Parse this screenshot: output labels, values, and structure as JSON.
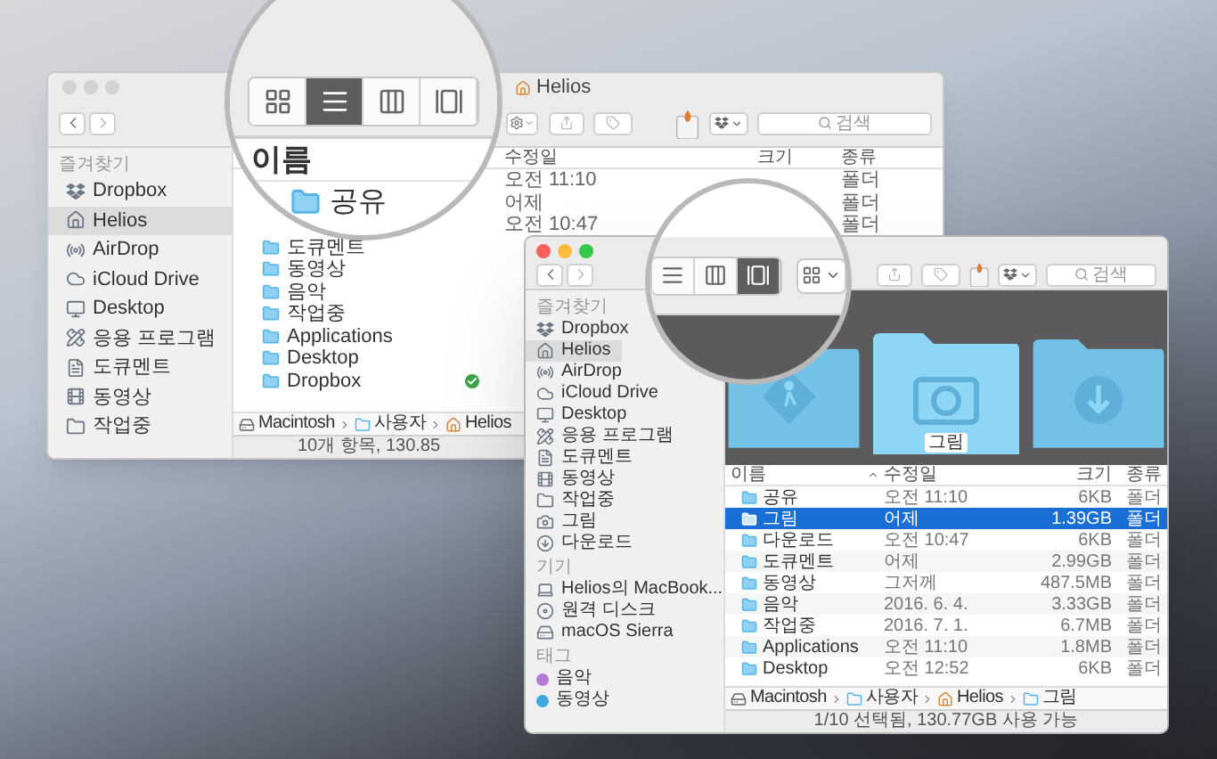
{
  "back_window": {
    "active": false,
    "title": "Helios",
    "search": {
      "placeholder": "검색"
    },
    "sidebar": [
      {
        "heading": "즐겨찾기",
        "items": [
          {
            "kind": "dropbox",
            "label": "Dropbox",
            "selected": false
          },
          {
            "kind": "home",
            "label": "Helios",
            "selected": true
          },
          {
            "kind": "airdrop",
            "label": "AirDrop",
            "selected": false
          },
          {
            "kind": "cloud",
            "label": "iCloud Drive",
            "selected": false
          },
          {
            "kind": "desktop",
            "label": "Desktop",
            "selected": false
          },
          {
            "kind": "apps",
            "label": "응용 프로그램",
            "selected": false
          },
          {
            "kind": "document",
            "label": "도큐멘트",
            "selected": false
          },
          {
            "kind": "film",
            "label": "동영상",
            "selected": false
          },
          {
            "kind": "folder",
            "label": "작업중",
            "selected": false
          }
        ]
      }
    ],
    "columns": {
      "modified": "수정일",
      "size": "크기",
      "type": "종류"
    },
    "rows": [
      {
        "modified": "오전 11:10",
        "type": "폴더",
        "synced": false
      },
      {
        "modified": "어제",
        "type": "폴더",
        "synced": false
      },
      {
        "modified": "오전 10:47",
        "type": "폴더",
        "synced": false
      },
      {
        "name": "도큐멘트",
        "synced": false
      },
      {
        "name": "동영상",
        "synced": false
      },
      {
        "name": "음악",
        "synced": false
      },
      {
        "name": "작업중",
        "synced": false
      },
      {
        "name": "Applications",
        "synced": false
      },
      {
        "name": "Desktop",
        "synced": false
      },
      {
        "name": "Dropbox",
        "synced": true
      }
    ],
    "path": [
      {
        "kind": "drive",
        "label": "Macintosh"
      },
      {
        "kind": "folder",
        "label": "사용자"
      },
      {
        "kind": "home",
        "label": "Helios"
      }
    ],
    "status": "10개 항목, 130.85"
  },
  "front_window": {
    "active": true,
    "search": {
      "placeholder": "검색"
    },
    "sidebar": [
      {
        "heading": "즐겨찾기",
        "items": [
          {
            "kind": "dropbox",
            "label": "Dropbox",
            "selected": false
          },
          {
            "kind": "home",
            "label": "Helios",
            "selected": true
          },
          {
            "kind": "airdrop",
            "label": "AirDrop",
            "selected": false
          },
          {
            "kind": "cloud",
            "label": "iCloud Drive",
            "selected": false
          },
          {
            "kind": "desktop",
            "label": "Desktop",
            "selected": false
          },
          {
            "kind": "apps",
            "label": "응용 프로그램",
            "selected": false
          },
          {
            "kind": "document",
            "label": "도큐멘트",
            "selected": false
          },
          {
            "kind": "film",
            "label": "동영상",
            "selected": false
          },
          {
            "kind": "folder",
            "label": "작업중",
            "selected": false
          },
          {
            "kind": "camera",
            "label": "그림",
            "selected": false
          },
          {
            "kind": "download",
            "label": "다운로드",
            "selected": false
          }
        ]
      },
      {
        "heading": "기기",
        "items": [
          {
            "kind": "laptop",
            "label": "Helios의 MacBook...",
            "selected": false
          },
          {
            "kind": "disc",
            "label": "원격 디스크",
            "selected": false
          },
          {
            "kind": "drive",
            "label": "macOS Sierra",
            "selected": false
          }
        ]
      },
      {
        "heading": "태그",
        "items": [
          {
            "kind": "tag",
            "label": "음악",
            "color": "#b57ad6",
            "selected": false
          },
          {
            "kind": "tag",
            "label": "동영상",
            "color": "#3fa6e0",
            "selected": false
          }
        ]
      }
    ],
    "preview": {
      "label": "그림"
    },
    "columns": {
      "name": "이름",
      "modified": "수정일",
      "size": "크기",
      "type": "종류"
    },
    "rows": [
      {
        "name": "공유",
        "modified": "오전 11:10",
        "size": "6KB",
        "type": "폴더",
        "selected": false
      },
      {
        "name": "그림",
        "modified": "어제",
        "size": "1.39GB",
        "type": "폴더",
        "selected": true
      },
      {
        "name": "다운로드",
        "modified": "오전 10:47",
        "size": "6KB",
        "type": "폴더",
        "selected": false
      },
      {
        "name": "도큐멘트",
        "modified": "어제",
        "size": "2.99GB",
        "type": "폴더",
        "selected": false
      },
      {
        "name": "동영상",
        "modified": "그저께",
        "size": "487.5MB",
        "type": "폴더",
        "selected": false
      },
      {
        "name": "음악",
        "modified": "2016. 6. 4.",
        "size": "3.33GB",
        "type": "폴더",
        "selected": false
      },
      {
        "name": "작업중",
        "modified": "2016. 7. 1.",
        "size": "6.7MB",
        "type": "폴더",
        "selected": false
      },
      {
        "name": "Applications",
        "modified": "오전 11:10",
        "size": "1.8MB",
        "type": "폴더",
        "selected": false
      },
      {
        "name": "Desktop",
        "modified": "오전 12:52",
        "size": "6KB",
        "type": "폴더",
        "selected": false
      }
    ],
    "path": [
      {
        "kind": "drive",
        "label": "Macintosh"
      },
      {
        "kind": "folder",
        "label": "사용자"
      },
      {
        "kind": "home",
        "label": "Helios"
      },
      {
        "kind": "folder",
        "label": "그림"
      }
    ],
    "status": "1/10 선택됨, 130.77GB 사용 가능"
  },
  "magnifiers": [
    {
      "view_buttons": [
        {
          "kind": "icon",
          "selected": false
        },
        {
          "kind": "list",
          "selected": true
        },
        {
          "kind": "column",
          "selected": false
        },
        {
          "kind": "coverflow",
          "selected": false
        }
      ],
      "column": "이름",
      "row": "공유"
    },
    {
      "view_buttons": [
        {
          "kind": "list",
          "selected": false
        },
        {
          "kind": "column",
          "selected": false
        },
        {
          "kind": "coverflow",
          "selected": true
        }
      ]
    }
  ]
}
